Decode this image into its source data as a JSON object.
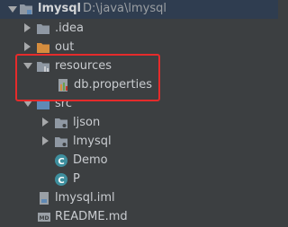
{
  "project": {
    "name": "lmysql",
    "path": "D:\\java\\lmysql"
  },
  "tree": {
    "idea": ".idea",
    "out": "out",
    "resources": "resources",
    "db_properties": "db.properties",
    "src": "src",
    "ljson": "ljson",
    "lmysql_pkg": "lmysql",
    "demo": "Demo",
    "p": "P",
    "iml": "lmysql.iml",
    "readme": "README.md"
  },
  "colors": {
    "background": "#3c3f41",
    "selected": "#2f3d50",
    "folder": "#8f98a3",
    "excluded_folder": "#d58d3e",
    "source_folder": "#5f89b5",
    "class_icon": "#3e8f9e",
    "highlight": "#e52b2b"
  }
}
